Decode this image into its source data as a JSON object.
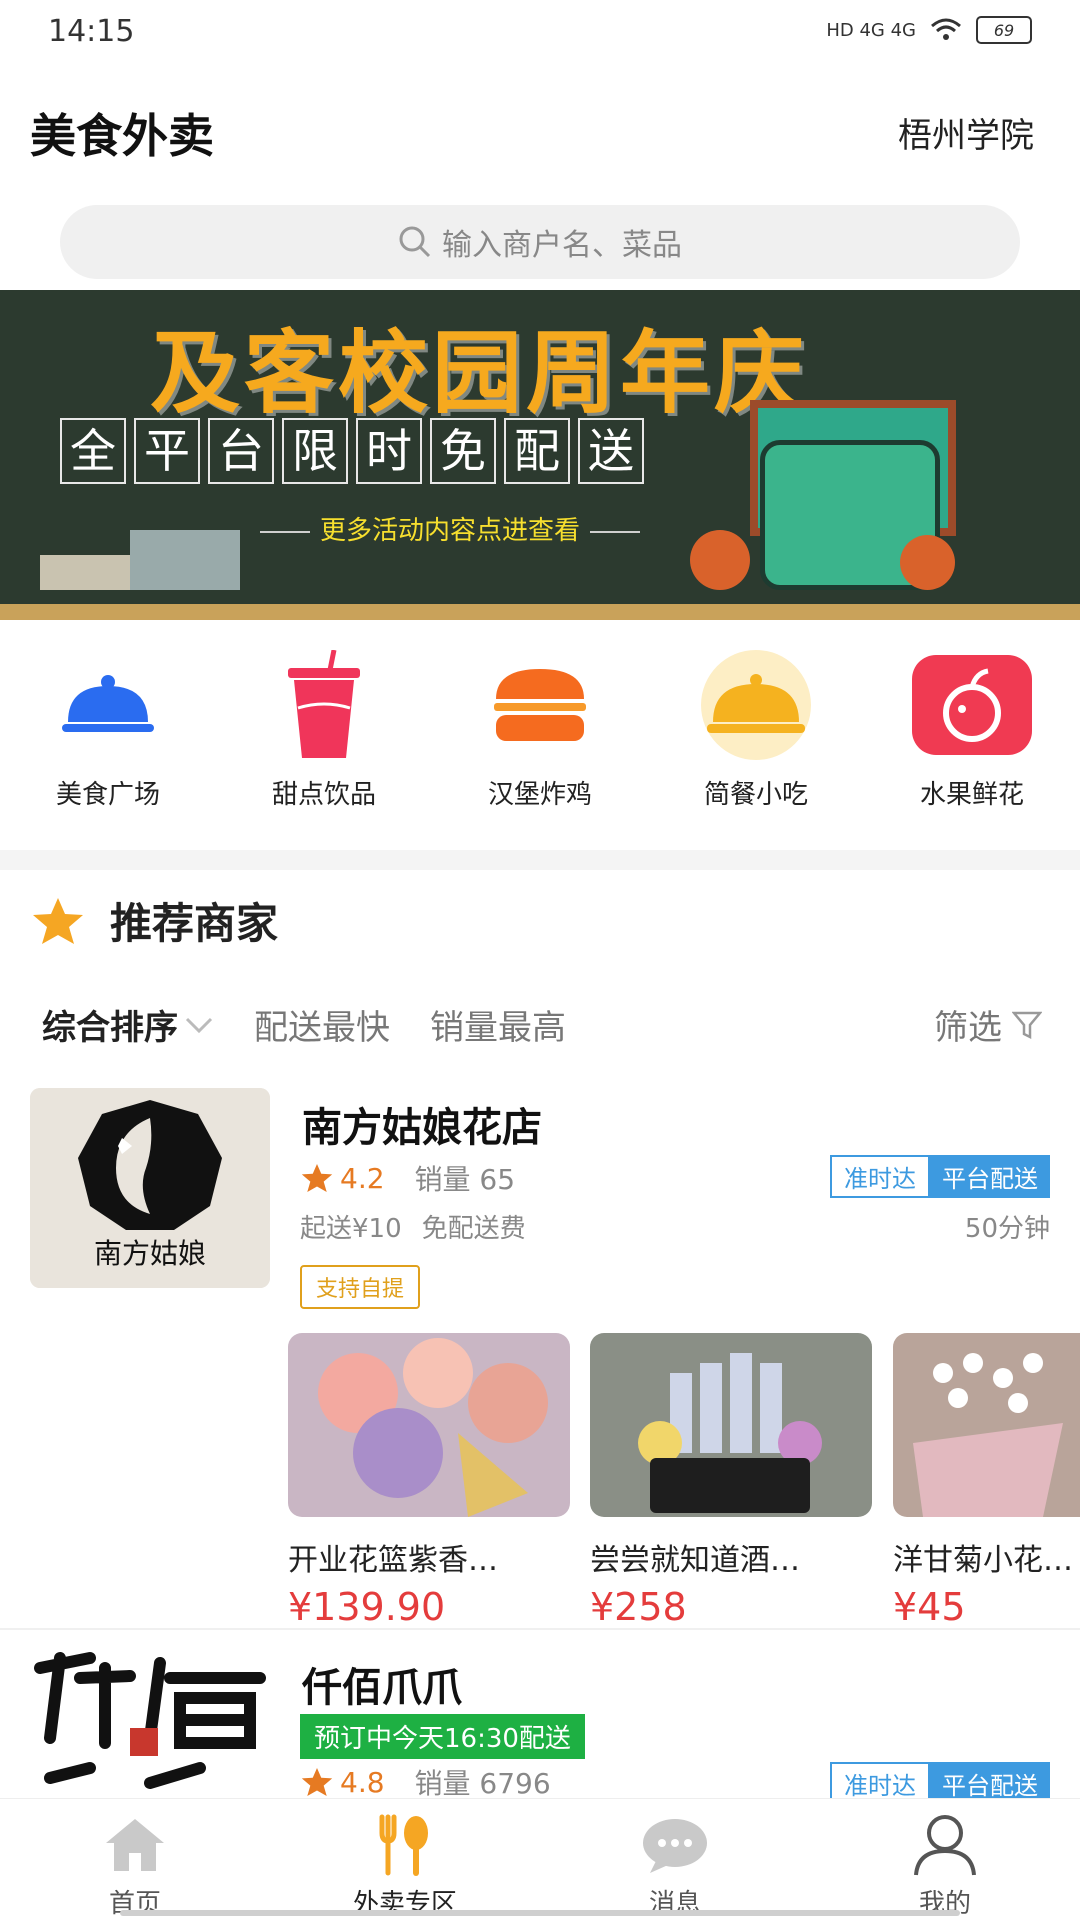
{
  "status_bar": {
    "time": "14:15",
    "network": "HD 4G 4G",
    "battery": "69"
  },
  "header": {
    "title": "美食外卖",
    "location": "梧州学院"
  },
  "search": {
    "placeholder": "输入商户名、菜品"
  },
  "banner": {
    "title": "及客校园周年庆",
    "subtitle_chars": [
      "全",
      "平",
      "台",
      "限",
      "时",
      "免",
      "配",
      "送"
    ],
    "link": "更多活动内容点进查看"
  },
  "categories": [
    {
      "label": "美食广场",
      "icon": "cloche-icon",
      "color": "#2a6cf0"
    },
    {
      "label": "甜点饮品",
      "icon": "drink-cup-icon",
      "color": "#f0355a"
    },
    {
      "label": "汉堡炸鸡",
      "icon": "burger-icon",
      "color": "#f56b1f"
    },
    {
      "label": "简餐小吃",
      "icon": "cloche-icon",
      "color": "#f5b21f"
    },
    {
      "label": "水果鲜花",
      "icon": "apple-icon",
      "color": "#f03a52"
    }
  ],
  "section": {
    "title": "推荐商家"
  },
  "sort": {
    "comprehensive": "综合排序",
    "fastest": "配送最快",
    "top_sales": "销量最高",
    "filter": "筛选"
  },
  "shops": [
    {
      "name": "南方姑娘花店",
      "logo_text": "南方姑娘",
      "rating": "4.2",
      "sales": "销量 65",
      "tag_on_time": "准时达",
      "tag_platform": "平台配送",
      "min_order": "起送¥10",
      "delivery_fee": "免配送费",
      "time": "50分钟",
      "pickup": "支持自提",
      "products": [
        {
          "name": "开业花篮紫香…",
          "price": "¥139.90"
        },
        {
          "name": "尝尝就知道酒…",
          "price": "¥258"
        },
        {
          "name": "洋甘菊小花…",
          "price": "¥45"
        }
      ]
    },
    {
      "name": "仟佰爪爪",
      "preorder": "预订中今天16:30配送",
      "rating": "4.8",
      "sales": "销量 6796",
      "tag_on_time": "准时达",
      "tag_platform": "平台配送"
    }
  ],
  "nav": [
    {
      "label": "首页",
      "icon": "home-icon"
    },
    {
      "label": "外卖专区",
      "icon": "fork-spoon-icon"
    },
    {
      "label": "消息",
      "icon": "chat-icon"
    },
    {
      "label": "我的",
      "icon": "user-icon"
    }
  ],
  "colors": {
    "accent": "#f5a623",
    "price": "#e43c3c",
    "tag_blue": "#3d9ae0",
    "preorder_green": "#1eb043"
  }
}
